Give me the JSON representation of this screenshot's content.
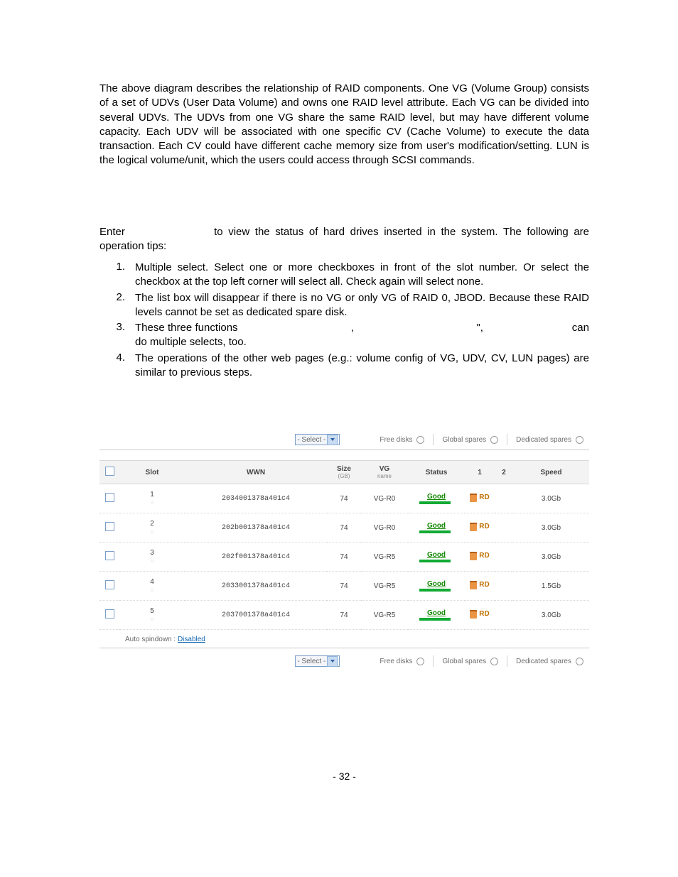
{
  "intro_paragraph": "The above diagram describes the relationship of RAID components. One VG (Volume Group) consists of a set of UDVs (User Data Volume) and owns one RAID level attribute. Each VG can be divided into several UDVs. The UDVs from one VG share the same RAID level, but may have different volume capacity. Each UDV will be associated with one specific CV (Cache Volume) to execute the data transaction. Each CV could have different cache memory size from user's modification/setting. LUN is the logical volume/unit, which the users could access through SCSI commands.",
  "enter_line_pre": "Enter",
  "enter_line_post": "to view the status of hard drives inserted in the system. The following are operation tips:",
  "tips": [
    "Multiple select. Select one or more checkboxes in front of the slot number. Or select the checkbox at the top left corner will select all. Check again will select none.",
    "The list box will disappear if there is no VG or only VG of RAID 0, JBOD.  Because these RAID levels cannot be set as dedicated spare disk.",
    "These three functions                                     ,                                        \",                             can do multiple selects, too.",
    "The operations of the other web pages (e.g.: volume config of VG, UDV, CV, LUN pages) are similar to previous steps."
  ],
  "toolbar": {
    "select_label": "- Select -",
    "free_disks": "Free disks",
    "global_spares": "Global spares",
    "dedicated_spares": "Dedicated spares"
  },
  "table": {
    "headers": {
      "slot": "Slot",
      "wwn": "WWN",
      "size": "Size",
      "size_sub": "(GB)",
      "vg": "VG",
      "vg_sub": "name",
      "status": "Status",
      "c1": "1",
      "c2": "2",
      "speed": "Speed"
    },
    "rows": [
      {
        "slot": "1",
        "wwn": "2034001378a401c4",
        "size": "74",
        "vg": "VG-R0",
        "status": "Good",
        "rd": "RD",
        "speed": "3.0Gb"
      },
      {
        "slot": "2",
        "wwn": "202b001378a401c4",
        "size": "74",
        "vg": "VG-R0",
        "status": "Good",
        "rd": "RD",
        "speed": "3.0Gb"
      },
      {
        "slot": "3",
        "wwn": "202f001378a401c4",
        "size": "74",
        "vg": "VG-R5",
        "status": "Good",
        "rd": "RD",
        "speed": "3.0Gb"
      },
      {
        "slot": "4",
        "wwn": "2033001378a401c4",
        "size": "74",
        "vg": "VG-R5",
        "status": "Good",
        "rd": "RD",
        "speed": "1.5Gb"
      },
      {
        "slot": "5",
        "wwn": "2037001378a401c4",
        "size": "74",
        "vg": "VG-R5",
        "status": "Good",
        "rd": "RD",
        "speed": "3.0Gb"
      }
    ]
  },
  "auto_spindown_label": "Auto spindown :  ",
  "auto_spindown_value": "Disabled",
  "page_number": "- 32 -"
}
